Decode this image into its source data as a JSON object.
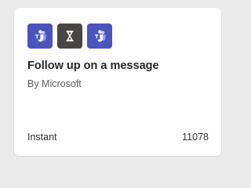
{
  "card": {
    "title": "Follow up on a message",
    "publisher": "By Microsoft",
    "trigger_type": "Instant",
    "count": "11078",
    "icons": [
      {
        "name": "teams-icon",
        "color": "#4b53bc"
      },
      {
        "name": "delay-icon",
        "color": "#484644"
      },
      {
        "name": "teams-icon",
        "color": "#4b53bc"
      }
    ]
  }
}
